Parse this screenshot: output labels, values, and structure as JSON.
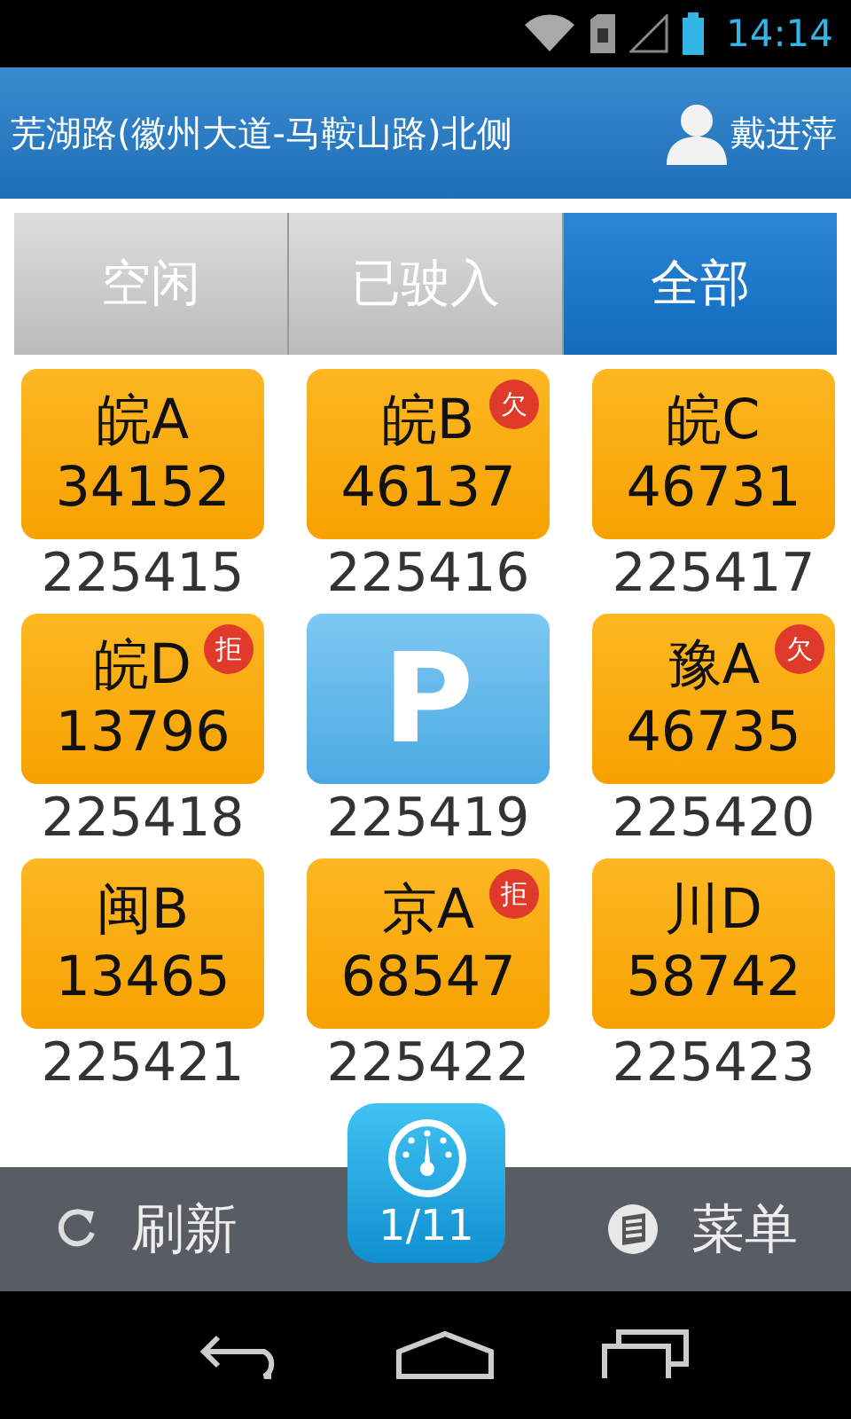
{
  "status_bar": {
    "time": "14:14"
  },
  "header": {
    "title": "芜湖路(徽州大道-马鞍山路)北侧",
    "user": "戴进萍"
  },
  "tabs": [
    {
      "label": "空闲",
      "selected": false
    },
    {
      "label": "已驶入",
      "selected": false
    },
    {
      "label": "全部",
      "selected": true
    }
  ],
  "spaces": [
    {
      "kind": "plate",
      "region": "皖A",
      "plate": "34152",
      "number": "225415"
    },
    {
      "kind": "plate",
      "region": "皖B",
      "plate": "46137",
      "badge": "欠",
      "number": "225416"
    },
    {
      "kind": "plate",
      "region": "皖C",
      "plate": "46731",
      "number": "225417"
    },
    {
      "kind": "plate",
      "region": "皖D",
      "plate": "13796",
      "badge": "拒",
      "number": "225418"
    },
    {
      "kind": "empty",
      "symbol": "P",
      "number": "225419"
    },
    {
      "kind": "plate",
      "region": "豫A",
      "plate": "46735",
      "badge": "欠",
      "number": "225420"
    },
    {
      "kind": "plate",
      "region": "闽B",
      "plate": "13465",
      "number": "225421"
    },
    {
      "kind": "plate",
      "region": "京A",
      "plate": "68547",
      "badge": "拒",
      "number": "225422"
    },
    {
      "kind": "plate",
      "region": "川D",
      "plate": "58742",
      "number": "225423"
    }
  ],
  "bottom_bar": {
    "refresh": "刷新",
    "page": "1/11",
    "menu": "菜单"
  }
}
